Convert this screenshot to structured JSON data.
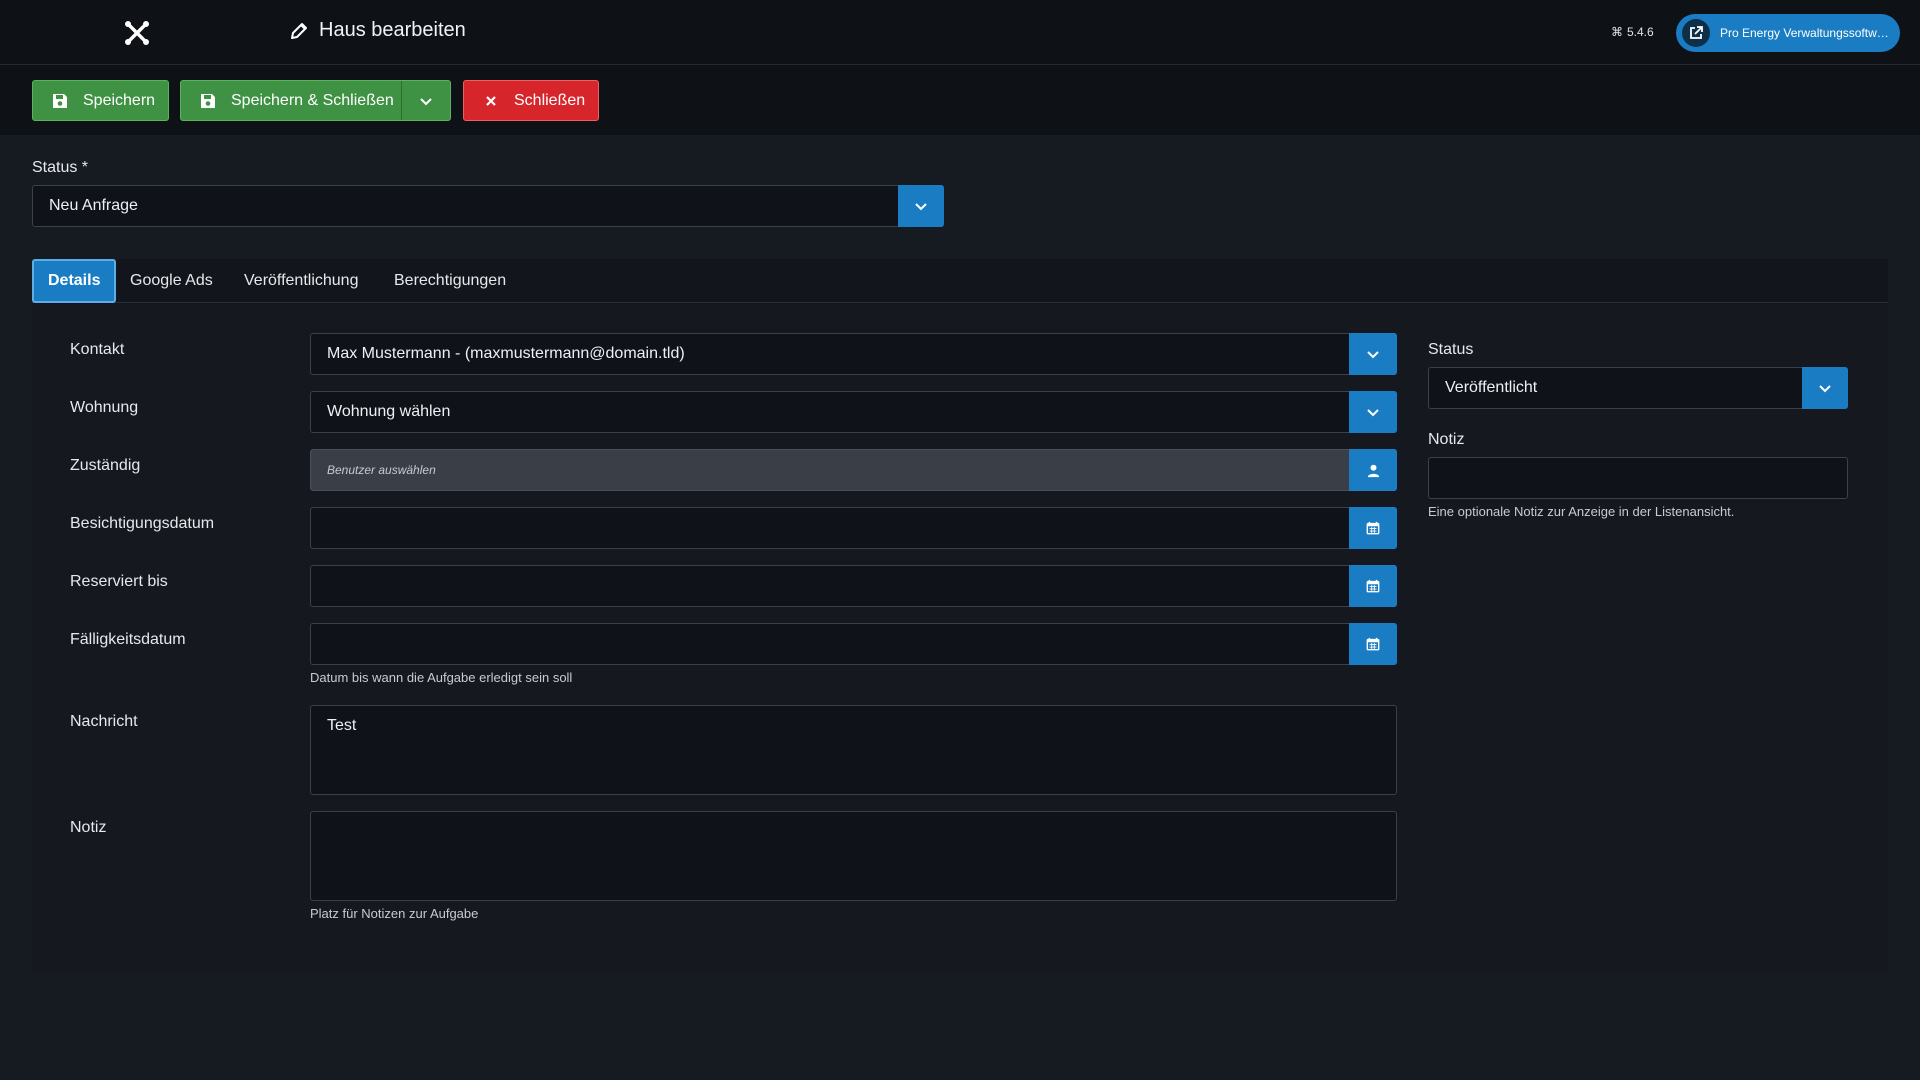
{
  "header": {
    "title": "Haus bearbeiten",
    "version": "5.4.6",
    "site_link": "Pro Energy Verwaltungssoftwa..."
  },
  "toolbar": {
    "save_label": "Speichern",
    "save_close_label": "Speichern & Schließen",
    "close_label": "Schließen"
  },
  "status_field": {
    "label": "Status *",
    "value": "Neu Anfrage"
  },
  "tabs": [
    {
      "label": "Details",
      "active": true
    },
    {
      "label": "Google Ads",
      "active": false
    },
    {
      "label": "Veröffentlichung",
      "active": false
    },
    {
      "label": "Berechtigungen",
      "active": false
    }
  ],
  "form": {
    "kontakt": {
      "label": "Kontakt",
      "value": "Max Mustermann - (maxmustermann@domain.tld)"
    },
    "wohnung": {
      "label": "Wohnung",
      "value": "Wohnung wählen"
    },
    "zustaendig": {
      "label": "Zuständig",
      "placeholder": "Benutzer auswählen"
    },
    "besichtigungsdatum": {
      "label": "Besichtigungsdatum",
      "value": ""
    },
    "reserviert_bis": {
      "label": "Reserviert bis",
      "value": ""
    },
    "faelligkeitsdatum": {
      "label": "Fälligkeitsdatum",
      "value": "",
      "hint": "Datum bis wann die Aufgabe erledigt sein soll"
    },
    "nachricht": {
      "label": "Nachricht",
      "value": "Test"
    },
    "notiz": {
      "label": "Notiz",
      "value": "",
      "hint": "Platz für Notizen zur Aufgabe"
    }
  },
  "sidebar": {
    "status": {
      "label": "Status",
      "value": "Veröffentlicht"
    },
    "notiz": {
      "label": "Notiz",
      "value": "",
      "hint": "Eine optionale Notiz zur Anzeige in der Listenansicht."
    }
  },
  "colors": {
    "accent": "#1a7dc3",
    "save": "#3f9144",
    "close": "#d7262b",
    "background": "#161a21"
  }
}
